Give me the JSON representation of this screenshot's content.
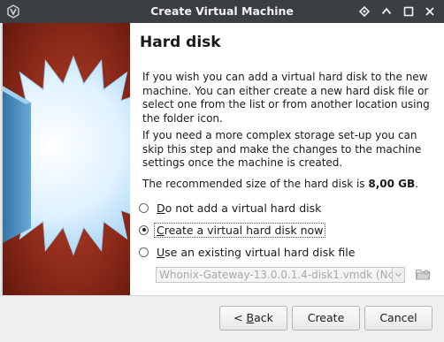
{
  "window": {
    "title": "Create Virtual Machine"
  },
  "page": {
    "heading": "Hard disk",
    "para1": "If you wish you can add a virtual hard disk to the new machine. You can either create a new hard disk file or select one from the list or from another location using the folder icon.",
    "para2": "If you need a more complex storage set-up you can skip this step and make the changes to the machine settings once the machine is created.",
    "recommended_prefix": "The recommended size of the hard disk is ",
    "recommended_size": "8,00 GB",
    "recommended_suffix": "."
  },
  "options": [
    {
      "hotkey": "D",
      "rest": "o not add a virtual hard disk",
      "checked": false
    },
    {
      "hotkey": "C",
      "rest": "reate a virtual hard disk now",
      "checked": true
    },
    {
      "hotkey": "U",
      "rest": "se an existing virtual hard disk file",
      "checked": false
    }
  ],
  "existing_file": {
    "value": "Whonix-Gateway-13.0.0.1.4-disk1.vmdk (Nc",
    "enabled": false
  },
  "buttons": {
    "back_prefix": "< ",
    "back_hotkey": "B",
    "back_rest": "ack",
    "create": "Create",
    "cancel": "Cancel"
  },
  "icons": {
    "app": "virtualbox-icon",
    "pin": "pin-icon",
    "up": "keep-above-icon",
    "max": "maximize-icon",
    "close": "close-icon",
    "folder": "folder-icon"
  },
  "colors": {
    "titlebar": "#3a3f44",
    "image_bg": "#8c2a1a",
    "starburst": "#bfe4ff"
  }
}
